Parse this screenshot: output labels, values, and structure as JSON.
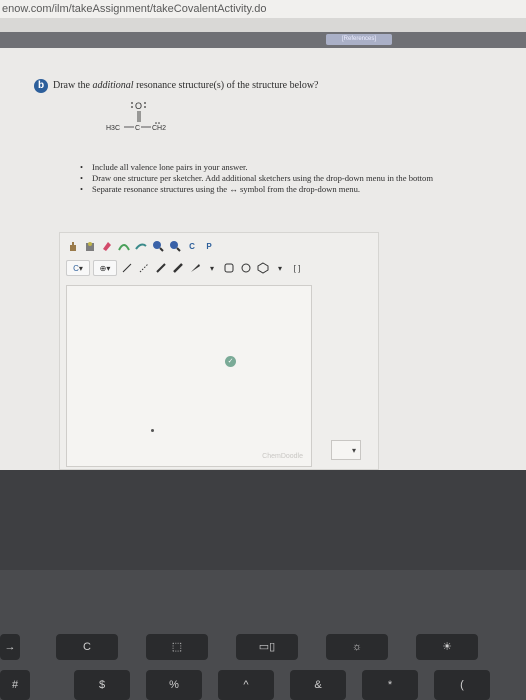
{
  "browser": {
    "url": "enow.com/ilm/takeAssignment/takeCovalentActivity.do"
  },
  "header": {
    "references_label": "[References]"
  },
  "question": {
    "part_label": "b",
    "prompt_before": "Draw the ",
    "prompt_italic": "additional",
    "prompt_after": " resonance structure(s) of the structure below?",
    "molecule": {
      "left_group": "H3C",
      "center_atom": "C",
      "right_group": "CH2",
      "top_atom": "O"
    }
  },
  "instructions": [
    "Include all valence lone pairs in your answer.",
    "Draw one structure per sketcher. Add additional sketchers using the drop-down menu in the bottom",
    "Separate resonance structures using the ↔ symbol from the drop-down menu."
  ],
  "sketcher": {
    "toolbar_row1": [
      "hand-tool",
      "lasso-tool",
      "eraser-tool",
      "ring-tool",
      "zoom-in",
      "zoom-out",
      "copy-tool",
      "paste-tool"
    ],
    "copy_label": "C",
    "paste_label": "P",
    "carbon_label": "C",
    "watermark": "ChemDoodle"
  },
  "keyboard": {
    "keys": [
      "→",
      "C",
      "⬚",
      "▭▯",
      "☼",
      "☀",
      "#",
      "$",
      "%",
      "^",
      "&",
      "*",
      "("
    ]
  }
}
